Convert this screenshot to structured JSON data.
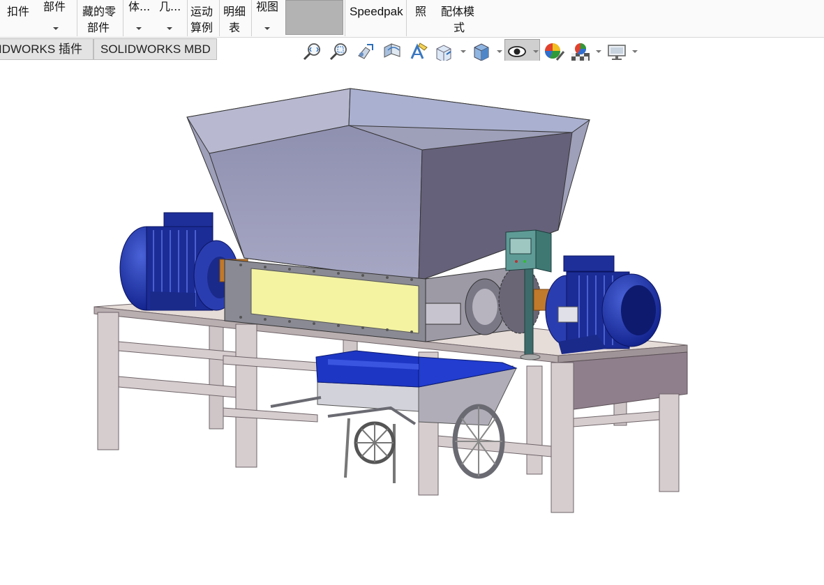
{
  "ribbon": {
    "fastener_label_top": "扣件",
    "parts_label": "部件",
    "hidden_parts_line1": "藏的零",
    "hidden_parts_line2": "部件",
    "body_label": "体...",
    "geometry_label": "几...",
    "motion_line1": "运动",
    "motion_line2": "算例",
    "bom_line1": "明细",
    "bom_line2": "表",
    "view_label": "视图",
    "speedpak_label": "Speedpak",
    "snapshot_label": "照",
    "assembly_line1": "配体模",
    "assembly_line2": "式"
  },
  "tabs": [
    {
      "label": "IDWORKS 插件"
    },
    {
      "label": "SOLIDWORKS MBD"
    }
  ],
  "heads_up_toolbar": {
    "icons": [
      "zoom-to-fit-icon",
      "zoom-to-area-icon",
      "previous-view-icon",
      "section-view-icon",
      "dynamic-annotation-icon",
      "view-orientation-icon",
      "display-style-icon",
      "hide-show-items-icon",
      "edit-appearance-icon",
      "apply-scene-icon",
      "view-settings-icon"
    ]
  },
  "model": {
    "description_hidden": "",
    "colors": {
      "hopper": "#9a9bb8",
      "motor": "#1e2f9a",
      "frame": "#d8cfd0",
      "window": "#f2f2a0",
      "shaft": "#c07a2c",
      "bin": "#1c36c8"
    }
  }
}
